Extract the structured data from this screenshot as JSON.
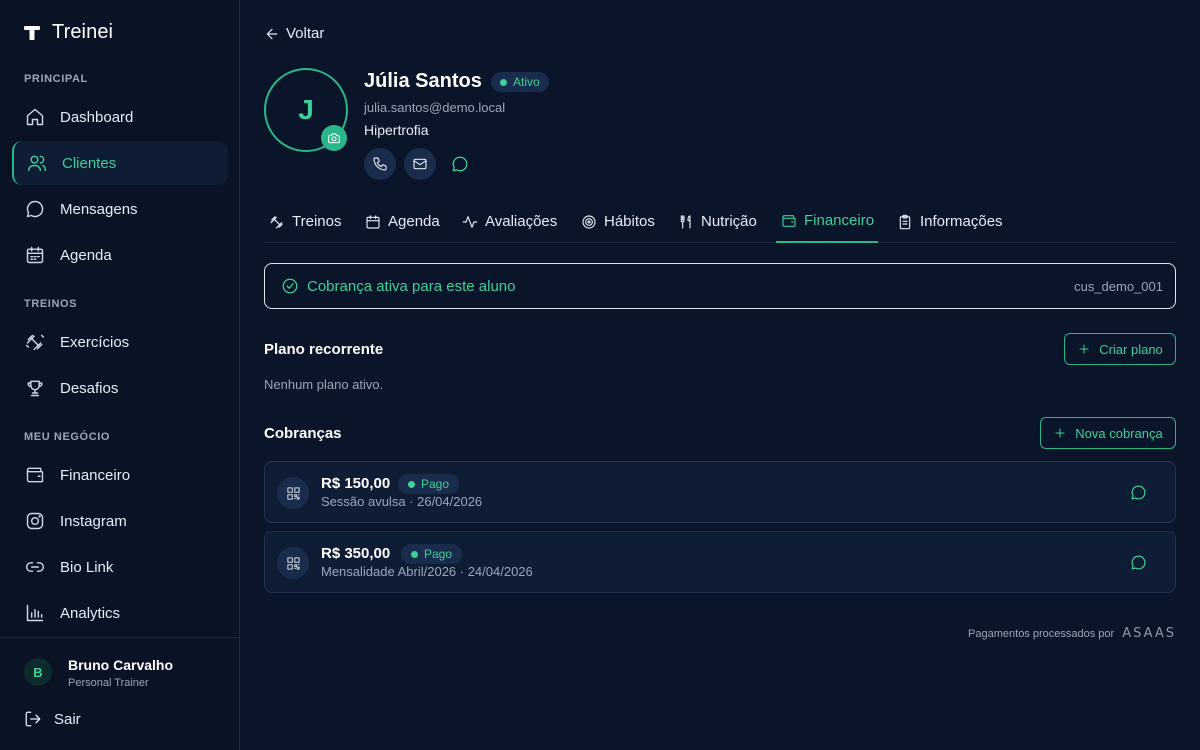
{
  "brand": {
    "name": "Treinei"
  },
  "sidebar": {
    "sections": {
      "principal": "PRINCIPAL",
      "treinos": "TREINOS",
      "negocio": "MEU NEGÓCIO"
    },
    "items": [
      {
        "label": "Dashboard",
        "icon": "home-icon"
      },
      {
        "label": "Clientes",
        "icon": "users-icon",
        "active": true
      },
      {
        "label": "Mensagens",
        "icon": "message-icon"
      },
      {
        "label": "Agenda",
        "icon": "calendar-icon"
      },
      {
        "label": "Exercícios",
        "icon": "dumbbell-icon"
      },
      {
        "label": "Desafios",
        "icon": "trophy-icon"
      },
      {
        "label": "Financeiro",
        "icon": "wallet-icon"
      },
      {
        "label": "Instagram",
        "icon": "instagram-icon"
      },
      {
        "label": "Bio Link",
        "icon": "link-icon"
      },
      {
        "label": "Analytics",
        "icon": "bar-chart-icon"
      }
    ],
    "user": {
      "initial": "B",
      "name": "Bruno Carvalho",
      "role": "Personal Trainer"
    },
    "logout_label": "Sair"
  },
  "back_label": "Voltar",
  "profile": {
    "initial": "J",
    "name": "Júlia Santos",
    "status": "Ativo",
    "email": "julia.santos@demo.local",
    "goal": "Hipertrofia"
  },
  "tabs": [
    {
      "label": "Treinos",
      "icon": "dumbbell-icon"
    },
    {
      "label": "Agenda",
      "icon": "calendar-icon"
    },
    {
      "label": "Avaliações",
      "icon": "activity-icon"
    },
    {
      "label": "Hábitos",
      "icon": "target-icon"
    },
    {
      "label": "Nutrição",
      "icon": "utensils-icon"
    },
    {
      "label": "Financeiro",
      "icon": "wallet-icon",
      "active": true
    },
    {
      "label": "Informações",
      "icon": "clipboard-icon"
    }
  ],
  "banner": {
    "text": "Cobrança ativa para este aluno",
    "customer_id": "cus_demo_001"
  },
  "plan": {
    "title": "Plano recorrente",
    "empty": "Nenhum plano ativo.",
    "create_label": "Criar plano"
  },
  "charges": {
    "title": "Cobranças",
    "new_label": "Nova cobrança",
    "items": [
      {
        "amount": "R$ 150,00",
        "status": "Pago",
        "description": "Sessão avulsa · 26/04/2026"
      },
      {
        "amount": "R$ 350,00",
        "status": "Pago",
        "description": "Mensalidade Abril/2026 · 24/04/2026"
      }
    ]
  },
  "footer": {
    "text": "Pagamentos processados por",
    "provider": "ASAAS"
  },
  "colors": {
    "accent": "#3ecf9a",
    "background": "#0b1529",
    "card": "#0f1d34"
  }
}
